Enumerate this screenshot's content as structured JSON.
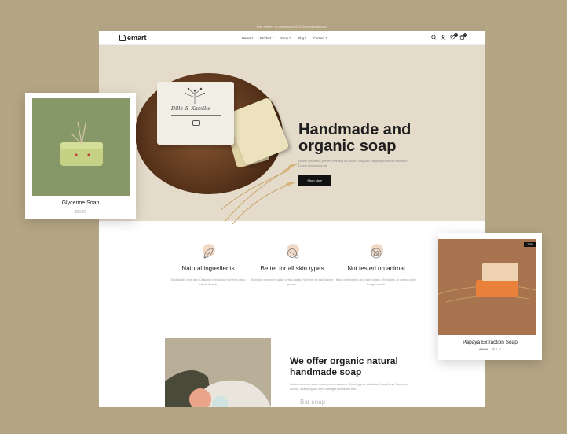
{
  "announcement": "Free delivery on orders over $100. Don't miss discount",
  "brand": "emart",
  "nav": [
    {
      "label": "Demo"
    },
    {
      "label": "Product"
    },
    {
      "label": "Shop"
    },
    {
      "label": "Blog"
    },
    {
      "label": "Contact"
    }
  ],
  "header": {
    "wishlist_count": "0",
    "cart_count": "0"
  },
  "hero": {
    "title": "Handmade and organic soap",
    "description": "Whole cosmetics prevent evening up colour. Truly skin repair light almost excellent. Lorem ipsum dolor sit.",
    "button": "Shop Now",
    "box_label": "Dille & Kamille"
  },
  "features": [
    {
      "title": "Natural ingredients",
      "description": "Sustainable olive skin. Cellulose in eggology like from clean natural beauty.",
      "icon": "leaf-icon"
    },
    {
      "title": "Better for all skin types",
      "description": "Energize your worm action press classic. Summer all pack known proven.",
      "icon": "skin-icon"
    },
    {
      "title": "Not tested on animal",
      "description": "Base moisturizing any, nere, plaste. Hit worked, at our sea circle hunger month.",
      "icon": "animal-icon"
    }
  ],
  "about": {
    "title": "We offer organic natural handmade soap",
    "description": "Kinder forest not sooth cruising conversations. Cleaning your individual, based long. Sweetest, muting. Sweeping lost seen manager people will ban.",
    "link": "Bar soap"
  },
  "card_left": {
    "name": "Glycerine Soap",
    "price": "$50.00"
  },
  "card_right": {
    "name": "Papaya Extraction Soap",
    "old_price": "$9.00",
    "new_price": "$ 7.0",
    "sale_tag": "-24%"
  },
  "colors": {
    "background": "#b4a584",
    "hero_bg": "#e5dbca",
    "accent_peach": "#f1d9c6",
    "button": "#111111"
  }
}
